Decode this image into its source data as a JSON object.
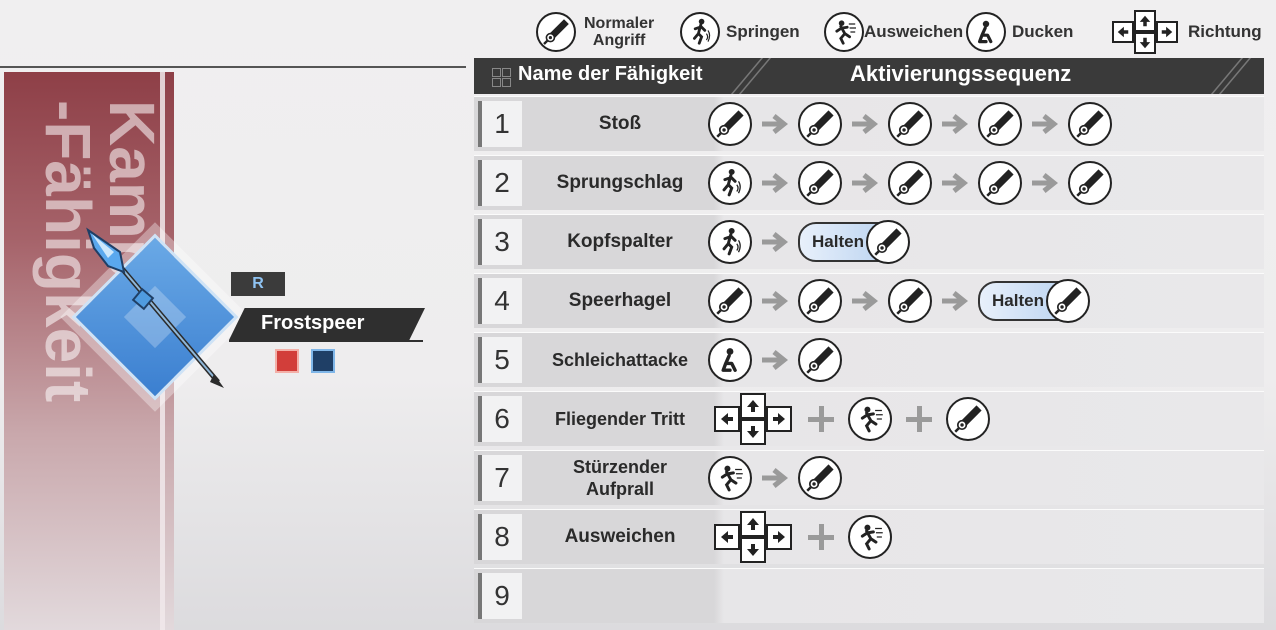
{
  "legend": {
    "normal_attack": {
      "label_line1": "Normaler",
      "label_line2": "Angriff",
      "icon": "sword-icon"
    },
    "jump": {
      "label": "Springen",
      "icon": "jump-icon"
    },
    "dodge": {
      "label": "Ausweichen",
      "icon": "dodge-icon"
    },
    "crouch": {
      "label": "Ducken",
      "icon": "crouch-icon"
    },
    "direction": {
      "label": "Richtung",
      "icon": "dpad-icon"
    }
  },
  "header": {
    "col_name": "Name der Fähigkeit",
    "col_sequence": "Aktivierungssequenz"
  },
  "left_panel": {
    "banner_line1": "Kampf",
    "banner_line2": "-Fähigkeit",
    "rarity": "R",
    "weapon_name": "Frostspeer",
    "tags": [
      "physical-icon",
      "ice-icon"
    ]
  },
  "hold_label": "Halten",
  "skills": [
    {
      "num": "1",
      "name": "Stoß"
    },
    {
      "num": "2",
      "name": "Sprungschlag"
    },
    {
      "num": "3",
      "name": "Kopfspalter"
    },
    {
      "num": "4",
      "name": "Speerhagel"
    },
    {
      "num": "5",
      "name": "Schleichattacke"
    },
    {
      "num": "6",
      "name": "Fliegender Tritt"
    },
    {
      "num": "7",
      "name": "Stürzender Aufprall"
    },
    {
      "num": "8",
      "name": "Ausweichen"
    },
    {
      "num": "9",
      "name": ""
    }
  ],
  "colors": {
    "header_bg": "#3a3a3a",
    "hold_pill": "#b9d2f0",
    "banner": "#8e3f47",
    "rarity_text": "#8fc3f2"
  }
}
